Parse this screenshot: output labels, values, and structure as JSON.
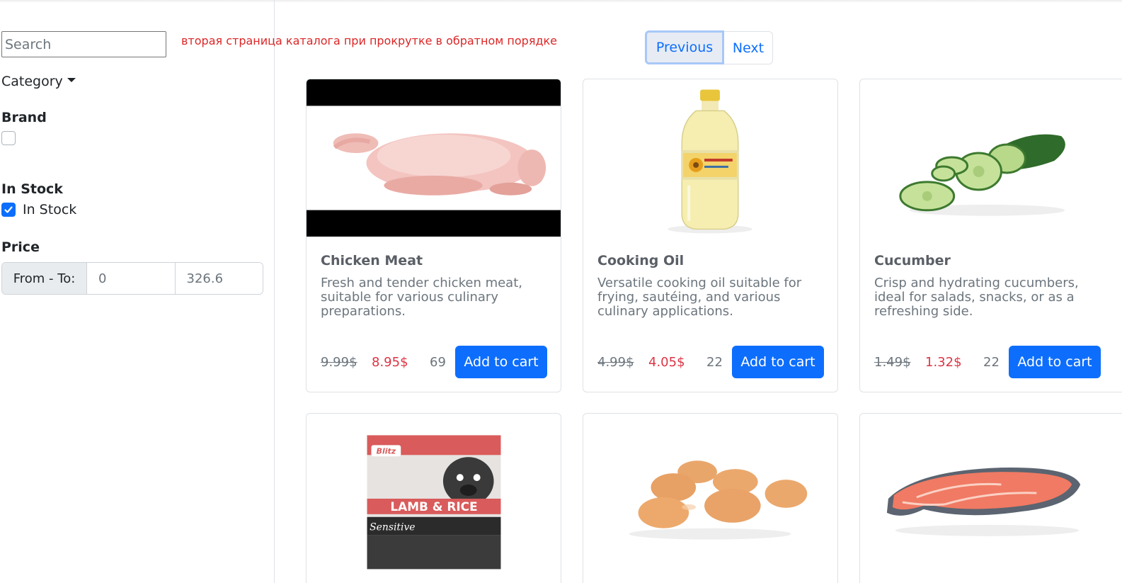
{
  "sidebar": {
    "search_placeholder": "Search",
    "category_label": "Category",
    "brand_title": "Brand",
    "brand_checked": false,
    "instock_title": "In Stock",
    "instock_label": "In Stock",
    "instock_checked": true,
    "price_title": "Price",
    "price_addon": "From - To:",
    "price_from": "0",
    "price_to": "326.6"
  },
  "note": "вторая страница каталога при прокрутке в обратном порядке",
  "pagination": {
    "previous": "Previous",
    "next": "Next"
  },
  "products": [
    {
      "name": "Chicken Meat",
      "description": "Fresh and tender chicken meat, suitable for various culinary preparations.",
      "old_price": "9.99$",
      "new_price": "8.95$",
      "stock": "69",
      "button": "Add to cart",
      "image_icon": "chicken-image"
    },
    {
      "name": "Cooking Oil",
      "description": "Versatile cooking oil suitable for frying, sautéing, and various culinary applications.",
      "old_price": "4.99$",
      "new_price": "4.05$",
      "stock": "22",
      "button": "Add to cart",
      "image_icon": "oil-bottle-image"
    },
    {
      "name": "Cucumber",
      "description": "Crisp and hydrating cucumbers, ideal for salads, snacks, or as a refreshing side.",
      "old_price": "1.49$",
      "new_price": "1.32$",
      "stock": "22",
      "button": "Add to cart",
      "image_icon": "cucumber-image"
    },
    {
      "package_brand": "Blitz",
      "package_text": "LAMB & RICE",
      "package_subtext": "Sensitive",
      "image_icon": "dog-food-bag-image"
    },
    {
      "image_icon": "eggs-image"
    },
    {
      "image_icon": "salmon-steak-image"
    }
  ],
  "colors": {
    "primary": "#0d6efd",
    "sale_price": "#dc3545",
    "note": "#dc2626"
  }
}
